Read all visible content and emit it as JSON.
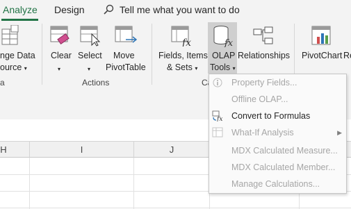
{
  "tabs": {
    "analyze": "Analyze",
    "design": "Design",
    "tell_me": "Tell me what you want to do"
  },
  "ribbon": {
    "change_data_source": {
      "line1": "nge Data",
      "line2": "ource"
    },
    "clear": "Clear",
    "select": "Select",
    "move_pivottable": {
      "line1": "Move",
      "line2": "PivotTable"
    },
    "fields_items_sets": {
      "line1": "Fields, Items,",
      "line2": "& Sets"
    },
    "olap_tools": {
      "line1": "OLAP",
      "line2": "Tools"
    },
    "relationships": "Relationships",
    "pivotchart": "PivotChart",
    "recommended_partial": "Reco",
    "group_actions": "Actions",
    "group_left_partial": "a",
    "group_calc_partial": "Ca"
  },
  "grid": {
    "col_h": "H",
    "col_i": "I",
    "col_j": "J"
  },
  "menu": {
    "items": [
      {
        "label": "Property Fields...",
        "enabled": false
      },
      {
        "label": "Offline OLAP...",
        "enabled": false
      },
      {
        "label": "Convert to Formulas",
        "enabled": true
      },
      {
        "label": "What-If Analysis",
        "enabled": false
      },
      {
        "label": "MDX Calculated Measure...",
        "enabled": false
      },
      {
        "label": "MDX Calculated Member...",
        "enabled": false
      },
      {
        "label": "Manage Calculations...",
        "enabled": false
      }
    ]
  },
  "colors": {
    "accent": "#217346",
    "ribbon_bg": "#f3f3f3",
    "disabled_text": "#a6a6a6",
    "pressed_button": "#cfcfcf"
  }
}
